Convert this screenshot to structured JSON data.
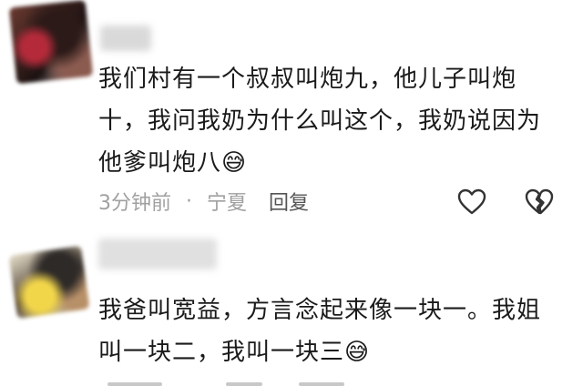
{
  "comments": [
    {
      "text": "我们村有一个叔叔叫炮九，他儿子叫炮十，我问我奶为什么叫这个，我奶说因为他爹叫炮八",
      "lines": [
        "我们村有一个叔叔叫炮九，他儿子叫炮",
        "十，我问我奶为什么叫这个，我奶说因为",
        "他爹叫炮八"
      ],
      "emoji": "😅",
      "time": "3分钟前",
      "separator": "·",
      "location": "宁夏",
      "reply_label": "回复",
      "like_icon": "heart-icon",
      "dislike_icon": "broken-heart-icon"
    },
    {
      "text": "我爸叫宽益，方言念起来像一块一。我姐叫一块二，我叫一块三",
      "lines": [
        "我爸叫宽益，方言念起来像一块一。我姐",
        "叫一块二，我叫一块三"
      ],
      "emoji": "😅"
    }
  ],
  "colors": {
    "text": "#1a1a1a",
    "meta": "#a0a0a0",
    "reply": "#555555",
    "icon": "#333333"
  }
}
